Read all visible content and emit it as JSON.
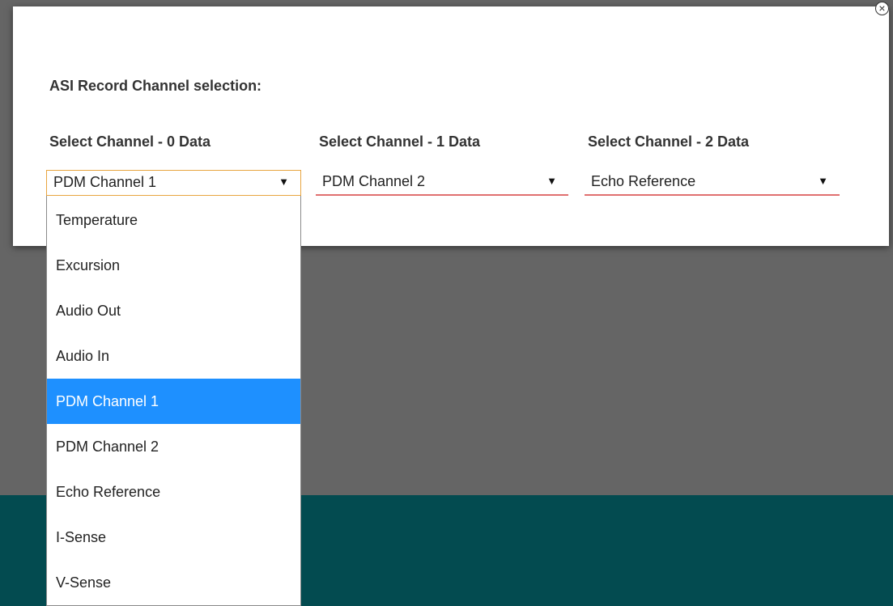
{
  "dialog": {
    "title": "ASI Record Channel selection:",
    "close_symbol": "×"
  },
  "channels": [
    {
      "label": "Select Channel - 0 Data",
      "value": "PDM Channel 1",
      "arrow": "▼"
    },
    {
      "label": "Select Channel - 1 Data",
      "value": "PDM Channel 2",
      "arrow": "▼"
    },
    {
      "label": "Select Channel - 2 Data",
      "value": "Echo Reference",
      "arrow": "▼"
    }
  ],
  "dropdown": {
    "options": [
      "Temperature",
      "Excursion",
      "Audio Out",
      "Audio In",
      "PDM Channel 1",
      "PDM Channel 2",
      "Echo Reference",
      "I-Sense",
      "V-Sense"
    ],
    "selected_index": 4
  },
  "colors": {
    "highlight": "#1e90ff",
    "focus_border": "#e8a540",
    "invalid_underline": "#e07070",
    "background_teal": "#034b50"
  }
}
